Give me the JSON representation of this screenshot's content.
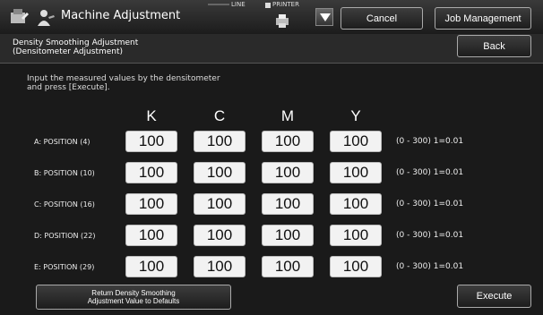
{
  "header": {
    "title": "Machine Adjustment",
    "line_label": "LINE",
    "printer_label": "PRINTER",
    "cancel_label": "Cancel",
    "job_management_label": "Job Management"
  },
  "subheader": {
    "title_line1": "Density Smoothing Adjustment",
    "title_line2": "(Densitometer Adjustment)",
    "back_label": "Back"
  },
  "instructions": {
    "line1": "Input the measured values by the densitometer",
    "line2": "and press [Execute]."
  },
  "columns": [
    "K",
    "C",
    "M",
    "Y"
  ],
  "rows": [
    {
      "label": "A: POSITION (4)",
      "values": [
        "100",
        "100",
        "100",
        "100"
      ],
      "range": "(0 - 300) 1=0.01"
    },
    {
      "label": "B: POSITION (10)",
      "values": [
        "100",
        "100",
        "100",
        "100"
      ],
      "range": "(0 - 300) 1=0.01"
    },
    {
      "label": "C: POSITION (16)",
      "values": [
        "100",
        "100",
        "100",
        "100"
      ],
      "range": "(0 - 300) 1=0.01"
    },
    {
      "label": "D: POSITION (22)",
      "values": [
        "100",
        "100",
        "100",
        "100"
      ],
      "range": "(0 - 300) 1=0.01"
    },
    {
      "label": "E: POSITION (29)",
      "values": [
        "100",
        "100",
        "100",
        "100"
      ],
      "range": "(0 - 300) 1=0.01"
    }
  ],
  "footer": {
    "return_line1": "Return Density Smoothing",
    "return_line2": "Adjustment Value to Defaults",
    "execute_label": "Execute"
  }
}
